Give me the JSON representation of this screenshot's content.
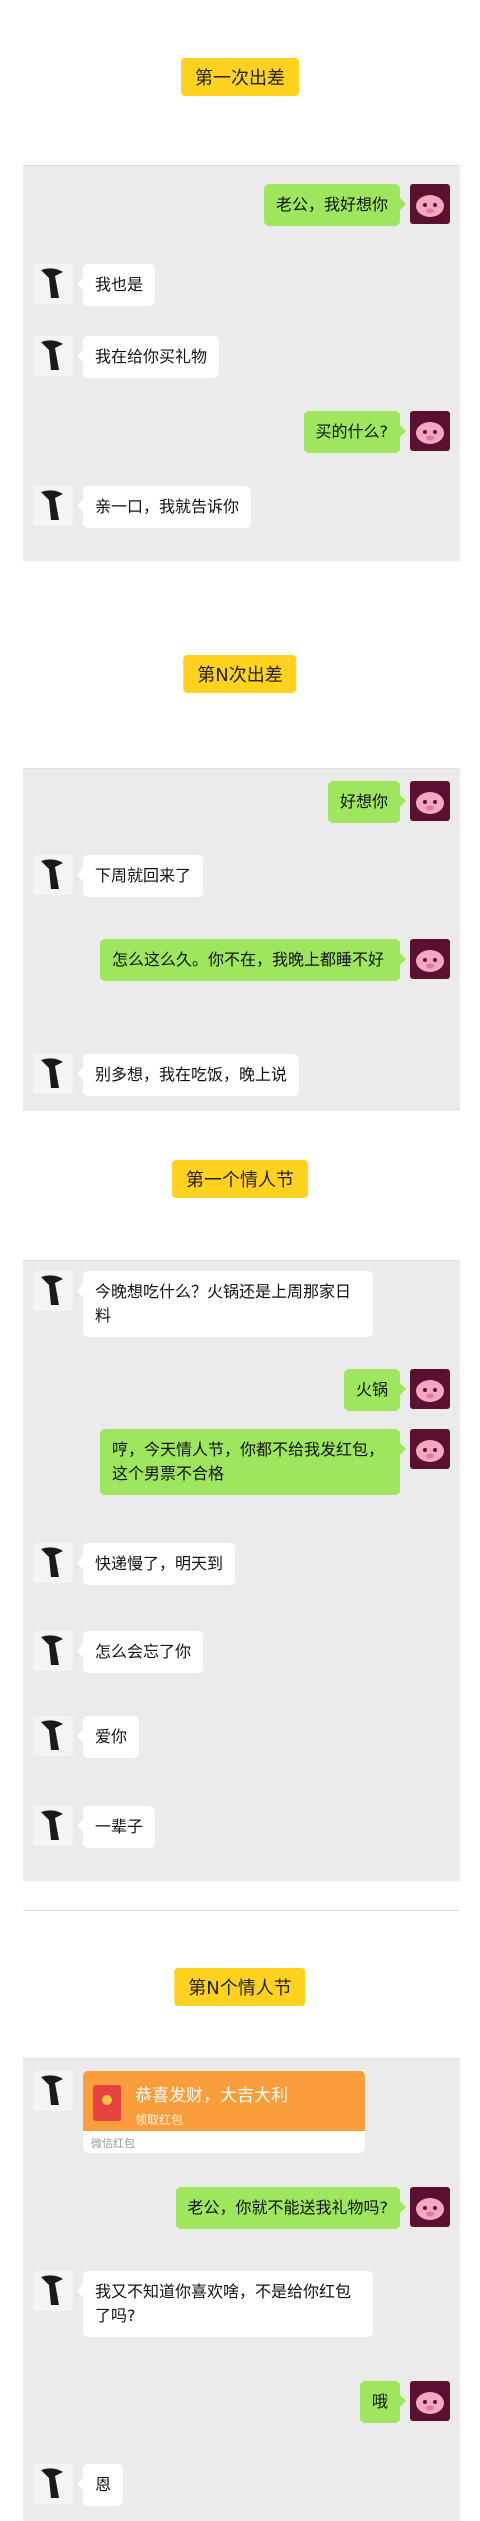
{
  "sections": [
    {
      "title": "第一次出差"
    },
    {
      "title": "第N次出差"
    },
    {
      "title": "第一个情人节"
    },
    {
      "title": "第N个情人节"
    }
  ],
  "messages": {
    "s1": [
      "老公，我好想你",
      "我也是",
      "我在给你买礼物",
      "买的什么?",
      "亲一口，我就告诉你"
    ],
    "s2": [
      "好想你",
      "下周就回来了",
      "怎么这么久。你不在，我晚上都睡不好",
      "别多想，我在吃饭，晚上说"
    ],
    "s3": [
      "今晚想吃什么？火锅还是上周那家日料",
      "火锅",
      "哼，今天情人节，你都不给我发红包，这个男票不合格",
      "快递慢了，明天到",
      "怎么会忘了你",
      "爱你",
      "一辈子"
    ],
    "s4": [
      "老公，你就不能送我礼物吗?",
      "我又不知道你喜欢啥，不是给你红包了吗?",
      "哦",
      "恩"
    ]
  },
  "red_packet": {
    "title": "恭喜发财，大吉大利",
    "subtitle": "领取红包",
    "footer": "微信红包"
  },
  "colors": {
    "label_bg": "#ffd21f",
    "chat_bg": "#ebebeb",
    "outgoing_bubble": "#9ee65e",
    "incoming_bubble": "#ffffff",
    "red_packet": "#fa9d3b"
  },
  "avatars": {
    "incoming": "dark-silhouette-avatar",
    "outgoing": "pink-cartoon-avatar"
  }
}
